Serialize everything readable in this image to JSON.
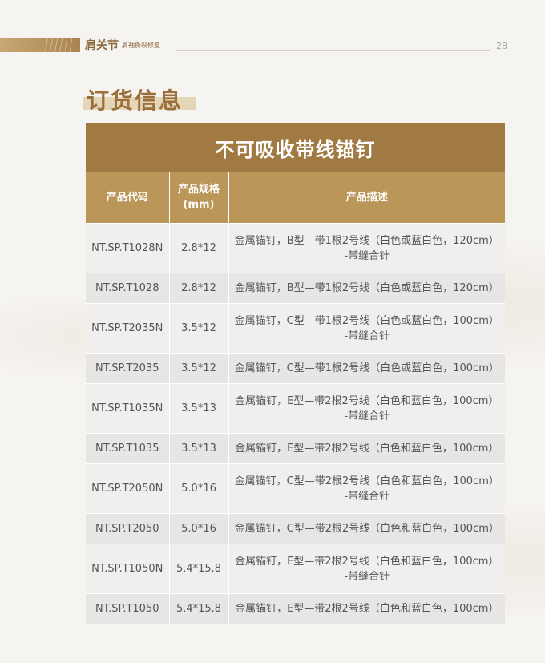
{
  "header": {
    "title": "肩关节",
    "subtitle": "肩袖撕裂修复",
    "page_number": "28"
  },
  "section_title": "订货信息",
  "table": {
    "banner": "不可吸收带线锚钉",
    "columns": [
      "产品代码",
      "产品规格\n(mm)",
      "产品描述"
    ],
    "rows": [
      {
        "code": "NT.SP.T1028N",
        "spec": "2.8*12",
        "desc1": "金属锚钉，B型—带1根2号线（白色或蓝白色，120cm）",
        "desc2": "-带缝合针"
      },
      {
        "code": "NT.SP.T1028",
        "spec": "2.8*12",
        "desc1": "金属锚钉，B型—带1根2号线（白色或蓝白色，120cm）",
        "desc2": ""
      },
      {
        "code": "NT.SP.T2035N",
        "spec": "3.5*12",
        "desc1": "金属锚钉，C型—带1根2号线（白色或蓝白色，100cm）",
        "desc2": "-带缝合针"
      },
      {
        "code": "NT.SP.T2035",
        "spec": "3.5*12",
        "desc1": "金属锚钉，C型—带1根2号线（白色或蓝白色，100cm）",
        "desc2": ""
      },
      {
        "code": "NT.SP.T1035N",
        "spec": "3.5*13",
        "desc1": "金属锚钉，E型—带2根2号线（白色和蓝白色，100cm）",
        "desc2": "-带缝合针"
      },
      {
        "code": "NT.SP.T1035",
        "spec": "3.5*13",
        "desc1": "金属锚钉，E型—带2根2号线（白色和蓝白色，100cm）",
        "desc2": ""
      },
      {
        "code": "NT.SP.T2050N",
        "spec": "5.0*16",
        "desc1": "金属锚钉，C型—带2根2号线（白色和蓝白色，100cm）",
        "desc2": "-带缝合针"
      },
      {
        "code": "NT.SP.T2050",
        "spec": "5.0*16",
        "desc1": "金属锚钉，C型—带2根2号线（白色和蓝白色，100cm）",
        "desc2": ""
      },
      {
        "code": "NT.SP.T1050N",
        "spec": "5.4*15.8",
        "desc1": "金属锚钉，E型—带2根2号线（白色和蓝白色，100cm）",
        "desc2": "-带缝合针"
      },
      {
        "code": "NT.SP.T1050",
        "spec": "5.4*15.8",
        "desc1": "金属锚钉，E型—带2根2号线（白色和蓝白色，100cm）",
        "desc2": ""
      }
    ]
  }
}
